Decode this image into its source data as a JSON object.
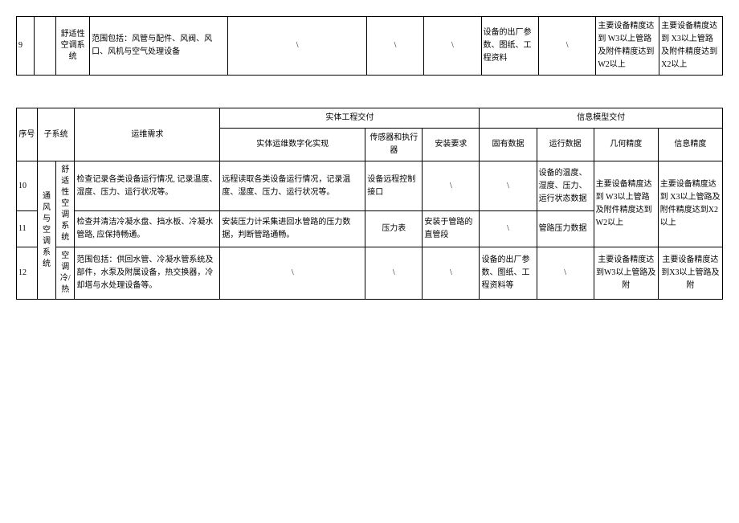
{
  "table1": {
    "row9": {
      "seq": "9",
      "sub2": "舒适性空调系统",
      "ywxq": "范围包括：风管与配件、风阀、风口、风机与空气处理设备",
      "sstx": "\\",
      "cgq": "\\",
      "azyq": "\\",
      "gysj": "设备的出厂参数、图纸、工程资料",
      "yxsj": "\\",
      "jhjd": "主要设备精度达到\nW3以上管路及附件精度达到W2以上",
      "xxjd": "主要设备精度达到\nX3以上管路及附件精度达到X2以上"
    }
  },
  "table2": {
    "headers": {
      "seq": "序号",
      "subsys": "子系统",
      "ywxq": "运维需求",
      "stgcjf": "实体工程交付",
      "sstx": "实体运维数字化实现",
      "cgq": "传感器和执行器",
      "azyq": "安装要求",
      "xxmxjf": "信息模型交付",
      "gysj": "固有数据",
      "yxsj": "运行数据",
      "jhjd": "几何精度",
      "xxjd": "信息精度"
    },
    "parent": "通风与空调系统",
    "sub_a": "舒适性空调系统",
    "sub_b": "空调冷/热",
    "row10": {
      "seq": "10",
      "ywxq": "检查记录各类设备运行情况, 记录温度、湿度、压力、运行状况等。",
      "sstx": "远程读取各类设备运行情况，记录温度、湿度、压力、运行状况等。",
      "cgq": "设备远程控制接口",
      "azyq": "\\",
      "gysj": "\\",
      "yxsj": "设备的温度、湿度、压力、运行状态数据",
      "jhjd_a": "主要设备精度达到\nW3以上管路及附件精度达到W2以上",
      "xxjd_a": "主要设备精度达到\nX3以上管路及附件精度达到X2以上"
    },
    "row11": {
      "seq": "11",
      "ywxq": "检查并清洁冷凝水盘、挡水板、冷凝水管路, 应保持畅通。",
      "sstx": "安装压力计采集进回水管路的压力数据，判断管路通畅。",
      "cgq": "压力表",
      "azyq": "安装于管路的直管段",
      "gysj": "\\",
      "yxsj": "管路压力数据"
    },
    "row12": {
      "seq": "12",
      "ywxq": "范围包括：供回水管、冷凝水管系统及部件，水泵及附属设备，热交换器，冷却塔与水处理设备等。",
      "sstx": "\\",
      "cgq": "\\",
      "azyq": "\\",
      "gysj": "设备的出厂参数、图纸、工程资料等",
      "yxsj": "\\",
      "jhjd": "主要设备精度达到W3以上管路及附",
      "xxjd": "主要设备精度达到X3以上管路及附"
    }
  }
}
